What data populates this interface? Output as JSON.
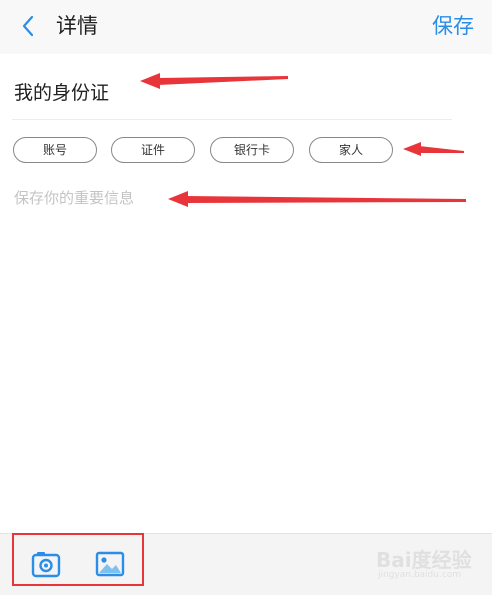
{
  "header": {
    "title": "详情",
    "save_label": "保存",
    "back_icon": "chevron-left-icon"
  },
  "note": {
    "title": "我的身份证",
    "placeholder": "保存你的重要信息"
  },
  "tags": [
    {
      "label": "账号"
    },
    {
      "label": "证件"
    },
    {
      "label": "银行卡"
    },
    {
      "label": "家人"
    }
  ],
  "toolbar": {
    "camera_icon": "camera-icon",
    "image_icon": "image-icon"
  },
  "watermark": {
    "brand": "Bai度经验",
    "url": "jingyan.baidu.com"
  },
  "colors": {
    "accent": "#2a8ee8",
    "annotation": "#e8353a"
  }
}
